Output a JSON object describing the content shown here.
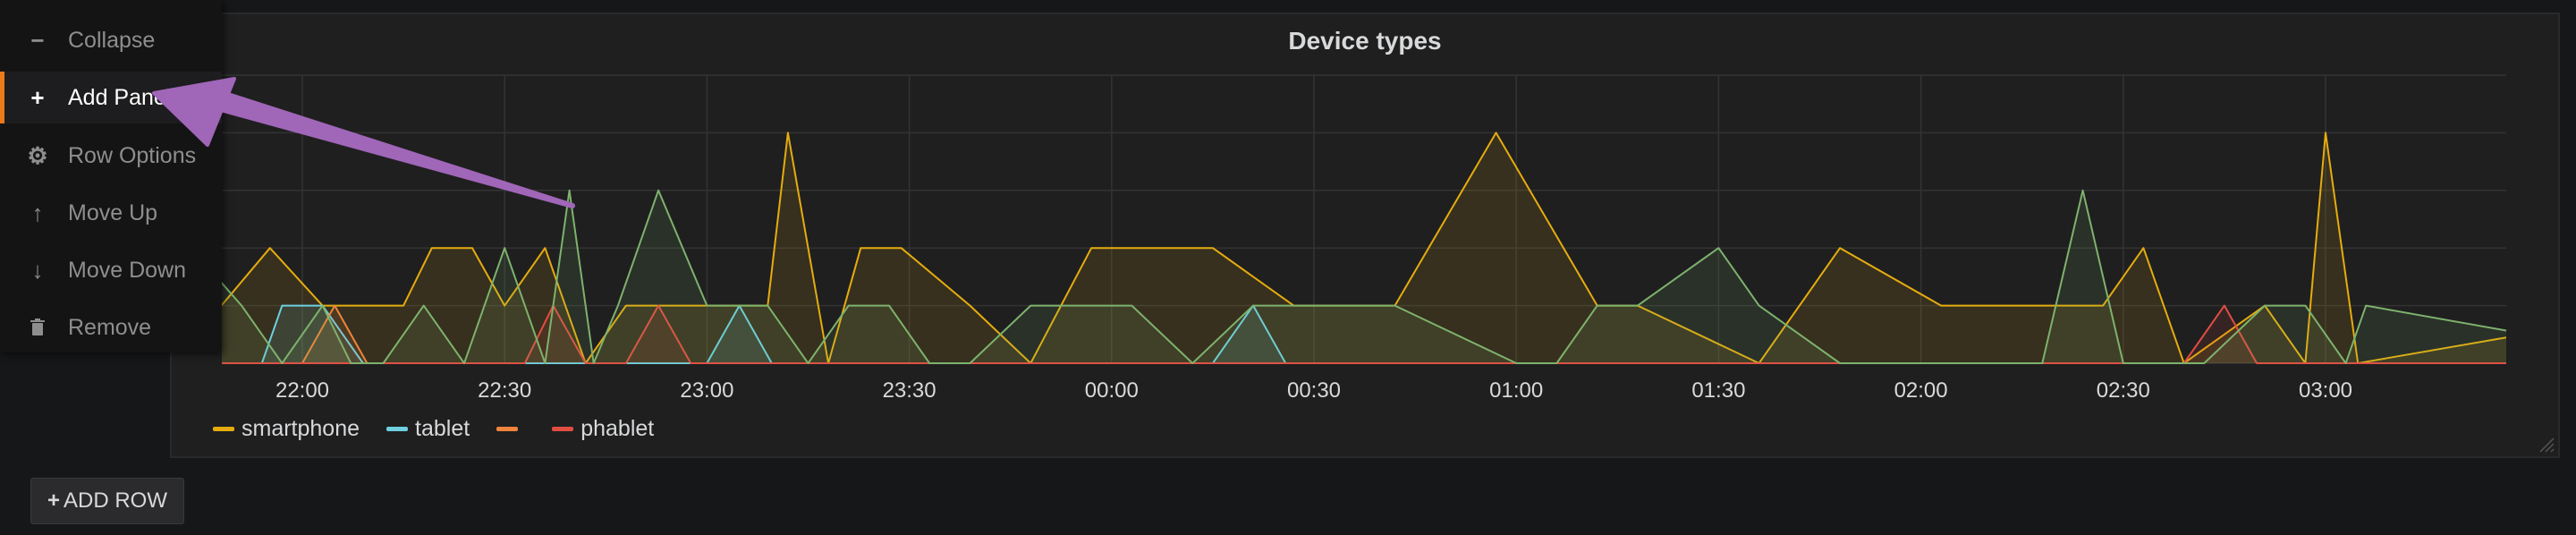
{
  "panel": {
    "title": "Device types"
  },
  "menu": {
    "items": [
      {
        "key": "collapse",
        "label": "Collapse",
        "icon": "minus-icon"
      },
      {
        "key": "add-panel",
        "label": "Add Panel",
        "icon": "plus-icon",
        "active": true
      },
      {
        "key": "row-options",
        "label": "Row Options",
        "icon": "gear-icon"
      },
      {
        "key": "move-up",
        "label": "Move Up",
        "icon": "arrow-up-icon"
      },
      {
        "key": "move-down",
        "label": "Move Down",
        "icon": "arrow-down-icon"
      },
      {
        "key": "remove",
        "label": "Remove",
        "icon": "trash-icon"
      }
    ]
  },
  "add_row": {
    "label": "ADD ROW",
    "icon": "plus-icon"
  },
  "colors": {
    "grid": "#333333",
    "axis_text": "#d8d9da",
    "active_accent": "#eb7b18",
    "annotation_arrow": "#a066b8"
  },
  "chart_data": {
    "type": "area",
    "title": "Device types",
    "xlabel": "",
    "ylabel": "",
    "x_ticks": [
      "22:00",
      "22:30",
      "23:00",
      "23:30",
      "00:00",
      "00:30",
      "01:00",
      "01:30",
      "02:00",
      "02:30",
      "03:00"
    ],
    "x_range_hours": [
      21.8,
      27.45
    ],
    "ylim": [
      0,
      5
    ],
    "grid": true,
    "legend_placement": "bottom-left",
    "series": [
      {
        "name": "smartphone",
        "color": "#e5ac0e",
        "points": [
          [
            21.8,
            1
          ],
          [
            21.92,
            2
          ],
          [
            22.05,
            1
          ],
          [
            22.25,
            1
          ],
          [
            22.32,
            2
          ],
          [
            22.42,
            2
          ],
          [
            22.5,
            1
          ],
          [
            22.6,
            2
          ],
          [
            22.7,
            0
          ],
          [
            22.8,
            1
          ],
          [
            23.15,
            1
          ],
          [
            23.2,
            4
          ],
          [
            23.3,
            0
          ],
          [
            23.38,
            2
          ],
          [
            23.48,
            2
          ],
          [
            23.65,
            1
          ],
          [
            23.8,
            0
          ],
          [
            23.95,
            2
          ],
          [
            24.25,
            2
          ],
          [
            24.45,
            1
          ],
          [
            24.55,
            1
          ],
          [
            24.7,
            1
          ],
          [
            24.95,
            4
          ],
          [
            25.2,
            1
          ],
          [
            25.3,
            1
          ],
          [
            25.6,
            0
          ],
          [
            25.8,
            2
          ],
          [
            26.05,
            1
          ],
          [
            26.45,
            1
          ],
          [
            26.55,
            2
          ],
          [
            26.65,
            0
          ],
          [
            26.85,
            1
          ],
          [
            26.95,
            0
          ],
          [
            27.0,
            4
          ],
          [
            27.08,
            0
          ],
          [
            27.9,
            1
          ]
        ]
      },
      {
        "name": "tablet",
        "color": "#6ed0e0",
        "points": [
          [
            21.8,
            0
          ],
          [
            21.9,
            0
          ],
          [
            21.95,
            1
          ],
          [
            22.05,
            1
          ],
          [
            22.15,
            0
          ],
          [
            23.0,
            0
          ],
          [
            23.08,
            1
          ],
          [
            23.16,
            0
          ],
          [
            24.25,
            0
          ],
          [
            24.35,
            1
          ],
          [
            24.43,
            0
          ]
        ]
      },
      {
        "name": "",
        "color": "#ef843c",
        "points": [
          [
            21.8,
            0
          ],
          [
            22.0,
            0
          ],
          [
            22.08,
            1
          ],
          [
            22.16,
            0
          ]
        ]
      },
      {
        "name": "phablet",
        "color": "#e24d42",
        "points": [
          [
            21.8,
            0
          ],
          [
            22.55,
            0
          ],
          [
            22.62,
            1
          ],
          [
            22.7,
            0
          ],
          [
            22.8,
            0
          ],
          [
            22.88,
            1
          ],
          [
            22.96,
            0
          ],
          [
            26.65,
            0
          ],
          [
            26.75,
            1
          ],
          [
            26.83,
            0
          ],
          [
            27.9,
            0
          ]
        ]
      },
      {
        "name": "",
        "color": "#7eb26d",
        "points": [
          [
            21.8,
            1.4
          ],
          [
            21.85,
            1
          ],
          [
            21.95,
            0
          ],
          [
            22.05,
            1
          ],
          [
            22.12,
            0
          ],
          [
            22.2,
            0
          ],
          [
            22.3,
            1
          ],
          [
            22.4,
            0
          ],
          [
            22.5,
            2
          ],
          [
            22.55,
            1
          ],
          [
            22.6,
            0
          ],
          [
            22.66,
            3
          ],
          [
            22.72,
            0
          ],
          [
            22.78,
            1
          ],
          [
            22.88,
            3
          ],
          [
            23.0,
            1
          ],
          [
            23.15,
            1
          ],
          [
            23.25,
            0
          ],
          [
            23.35,
            1
          ],
          [
            23.45,
            1
          ],
          [
            23.55,
            0
          ],
          [
            23.65,
            0
          ],
          [
            23.8,
            1
          ],
          [
            24.05,
            1
          ],
          [
            24.2,
            0
          ],
          [
            24.35,
            1
          ],
          [
            24.7,
            1
          ],
          [
            25.0,
            0
          ],
          [
            25.1,
            0
          ],
          [
            25.2,
            1
          ],
          [
            25.3,
            1
          ],
          [
            25.5,
            2
          ],
          [
            25.6,
            1
          ],
          [
            25.8,
            0
          ],
          [
            26.3,
            0
          ],
          [
            26.4,
            3
          ],
          [
            26.5,
            0
          ],
          [
            26.7,
            0
          ],
          [
            26.85,
            1
          ],
          [
            26.95,
            1
          ],
          [
            27.05,
            0
          ],
          [
            27.1,
            1
          ],
          [
            27.9,
            0
          ]
        ]
      }
    ]
  }
}
